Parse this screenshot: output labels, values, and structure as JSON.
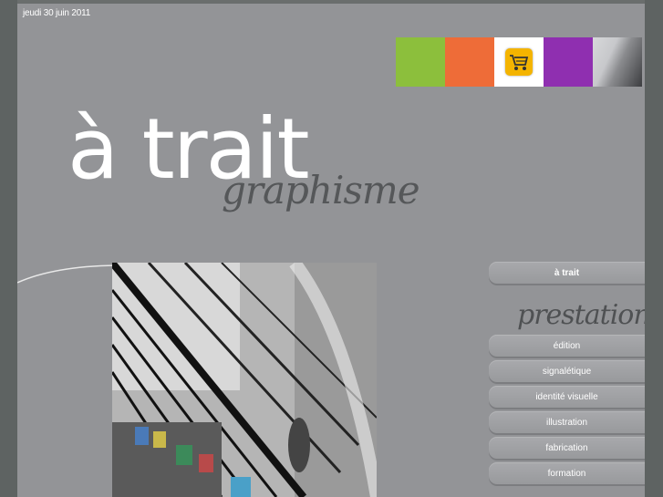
{
  "date": "jeudi 30 juin 2011",
  "logo": {
    "main": "à trait",
    "sub": "graphisme"
  },
  "header_icons": {
    "swatch_colors": [
      "#8cbf3c",
      "#ee6c38",
      "#ffffff",
      "#8f2fb0"
    ],
    "cart_icon": "shopping-cart-icon"
  },
  "nav": {
    "home_label": "à trait",
    "section_title": "prestations",
    "items": [
      "édition",
      "signalétique",
      "identité visuelle",
      "illustration",
      "fabrication",
      "formation"
    ]
  },
  "colors": {
    "page_bg": "#939497",
    "outer_bg": "#5e6362"
  }
}
